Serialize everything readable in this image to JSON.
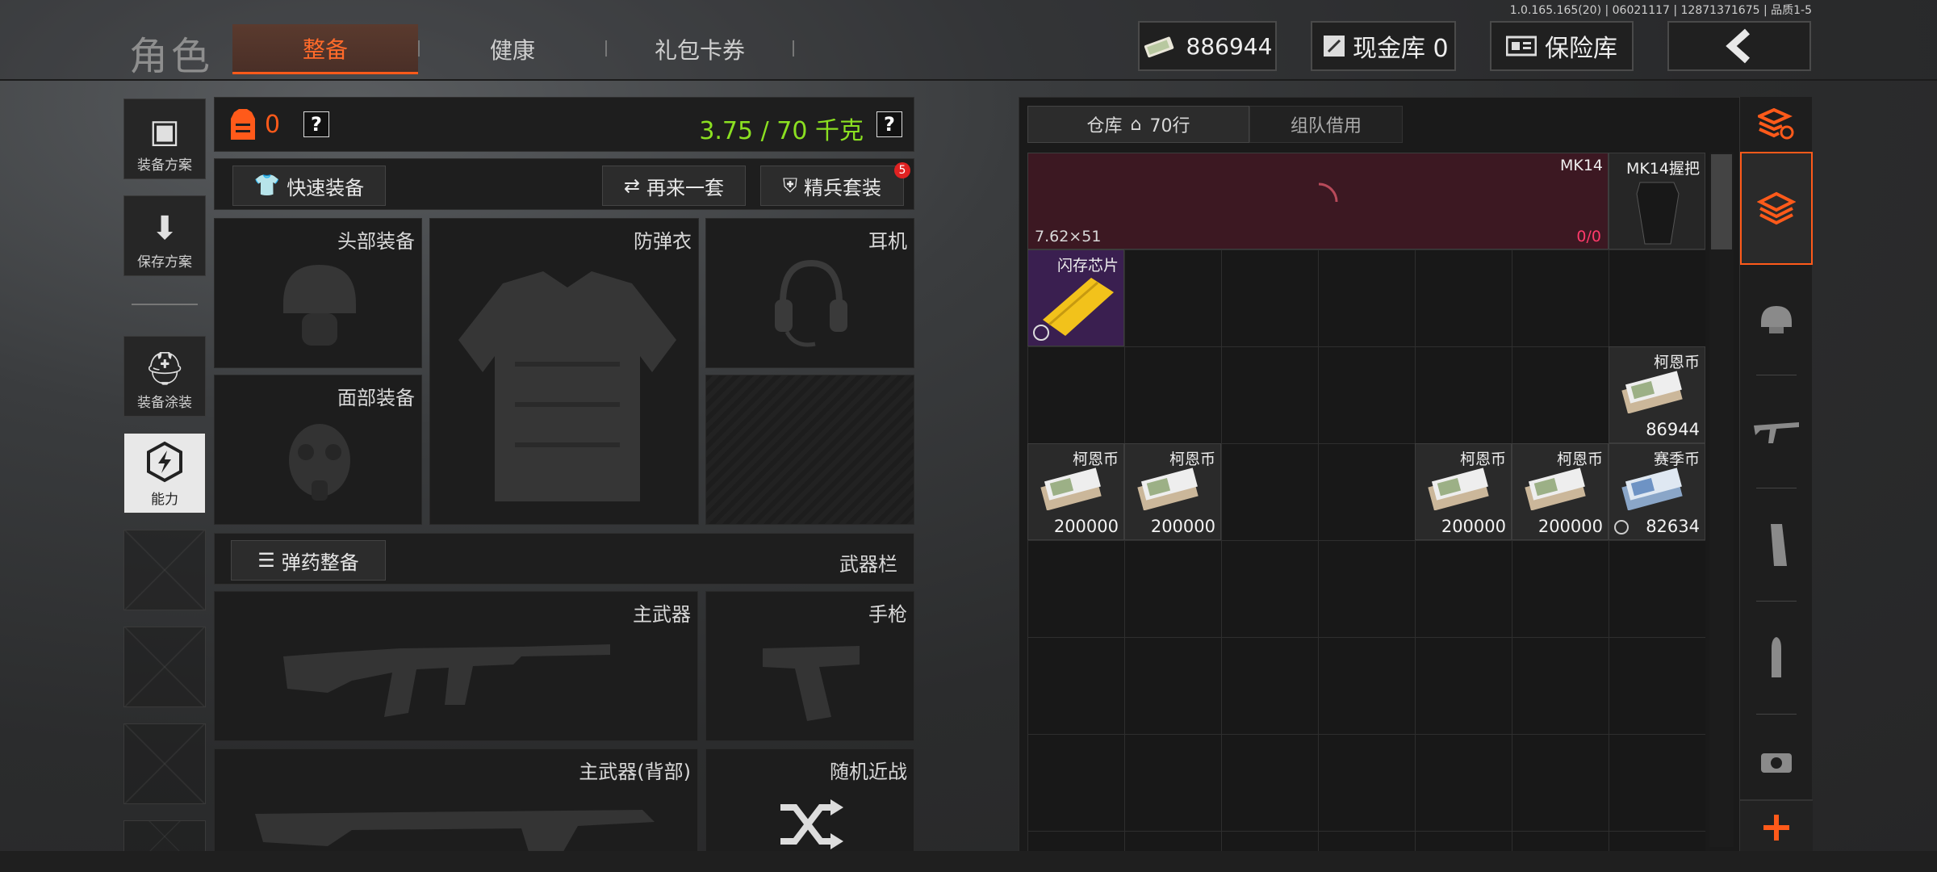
{
  "header": {
    "title": "角色",
    "tabs": [
      "整备",
      "健康",
      "礼包卡券"
    ],
    "version": "1.0.165.165(20) | 06021117 | 12871371675 | 品质1-5",
    "cash_amount": "886944",
    "cash_vault_label": "现金库 0",
    "safe_label": "保险库",
    "back_icon": "chevron-left-icon"
  },
  "left_sidebar": {
    "items": [
      "装备方案",
      "保存方案",
      "装备涂装",
      "能力"
    ]
  },
  "equipment": {
    "armor_count": "0",
    "weight": "3.75 / 70 千克",
    "quick_equip": "快速装备",
    "again": "再来一套",
    "elite": "精兵套装",
    "elite_badge": "5",
    "slots": {
      "head": "头部装备",
      "vest": "防弹衣",
      "ear": "耳机",
      "face": "面部装备"
    },
    "ammo_button": "弹药整备",
    "weapon_bar": "武器栏",
    "weapons": {
      "primary": "主武器",
      "pistol": "手枪",
      "primary_back": "主武器(背部)",
      "melee": "随机近战"
    }
  },
  "warehouse": {
    "tab_warehouse": "仓库",
    "rows": "70行",
    "tab_borrow": "组队借用",
    "items": [
      {
        "name": "MK14",
        "caliber": "7.62×51",
        "ammo": "0/0"
      },
      {
        "name": "MK14握把"
      },
      {
        "name": "闪存芯片"
      },
      {
        "name": "柯恩币",
        "count": "86944"
      },
      {
        "name": "柯恩币",
        "count": "200000"
      },
      {
        "name": "柯恩币",
        "count": "200000"
      },
      {
        "name": "柯恩币",
        "count": "200000"
      },
      {
        "name": "柯恩币",
        "count": "200000"
      },
      {
        "name": "赛季币",
        "count": "82634"
      }
    ]
  },
  "colors": {
    "accent": "#ff5a1a",
    "weight_green": "#8be021",
    "item_red": "#4a1a24",
    "item_purple": "#4a2466"
  }
}
